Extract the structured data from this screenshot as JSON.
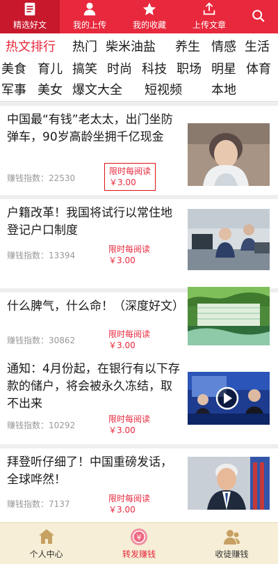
{
  "topnav": {
    "tabs": [
      {
        "label": "精选好文",
        "icon": "document-icon"
      },
      {
        "label": "我的上传",
        "icon": "user-icon"
      },
      {
        "label": "我的收藏",
        "icon": "star-icon"
      },
      {
        "label": "上传文章",
        "icon": "upload-icon"
      }
    ],
    "search_icon": "search-icon"
  },
  "categories": [
    "热文排行",
    "热门",
    "柴米油盐",
    "养生",
    "情感",
    "生活",
    "美食",
    "育儿",
    "搞笑",
    "时尚",
    "科技",
    "职场",
    "明星",
    "体育",
    "军事",
    "美女",
    "爆文大全",
    "短视频",
    "本地"
  ],
  "articles": [
    {
      "title": "中国最“有钱”老太太，出门坐防弹车，90岁高龄坐拥千亿现金",
      "index_label": "赚钱指数：",
      "index_value": "22530",
      "promo_label": "限时每阅读",
      "promo_price": "￥3.00"
    },
    {
      "title": "户籍改革！我国将试行以常住地登记户口制度",
      "index_label": "赚钱指数：",
      "index_value": "13394",
      "promo_label": "限时每阅读",
      "promo_price": "￥3.00"
    },
    {
      "title": "什么脾气，什么命！（深度好文）",
      "index_label": "赚钱指数：",
      "index_value": "30862",
      "promo_label": "限时每阅读",
      "promo_price": "￥3.00"
    },
    {
      "title": "通知：4月份起，在银行有以下存款的储户，将会被永久冻结，取不出来",
      "index_label": "赚钱指数：",
      "index_value": "10292",
      "promo_label": "限时每阅读",
      "promo_price": "￥3.00"
    },
    {
      "title": "拜登听仔细了！中国重磅发话，全球哗然！",
      "index_label": "赚钱指数：",
      "index_value": "7137",
      "promo_label": "限时每阅读",
      "promo_price": "￥3.00"
    }
  ],
  "bottom": {
    "items": [
      {
        "label": "个人中心",
        "icon": "home-icon"
      },
      {
        "label": "转发赚钱",
        "icon": "yen-coin-icon"
      },
      {
        "label": "收徒赚钱",
        "icon": "people-icon"
      }
    ]
  },
  "colors": {
    "brand": "#e8283c",
    "active_tab": "#c8182c",
    "bottom_bar": "#f6eed6"
  }
}
